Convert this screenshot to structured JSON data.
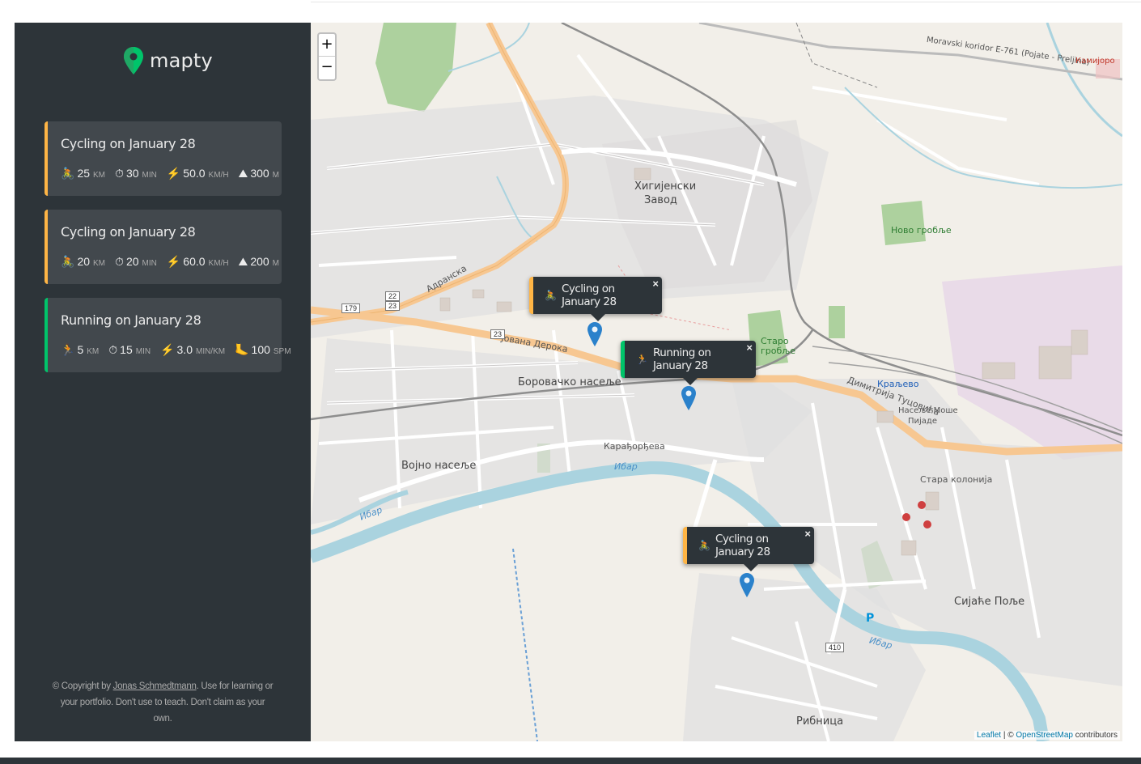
{
  "app": {
    "logo_text": "mapty",
    "brand_color": "#00c46a",
    "cycling_color": "#ffb545",
    "running_color": "#00c46a"
  },
  "workouts": [
    {
      "type": "cycling",
      "title": "Cycling on January 28",
      "d1_icon": "🚴",
      "d1_val": "25",
      "d1_unit": "KM",
      "d2_icon": "⏱",
      "d2_val": "30",
      "d2_unit": "MIN",
      "d3_icon": "⚡️",
      "d3_val": "50.0",
      "d3_unit": "KM/H",
      "d4_icon": "⛰",
      "d4_val": "300",
      "d4_unit": "M"
    },
    {
      "type": "cycling",
      "title": "Cycling on January 28",
      "d1_icon": "🚴",
      "d1_val": "20",
      "d1_unit": "KM",
      "d2_icon": "⏱",
      "d2_val": "20",
      "d2_unit": "MIN",
      "d3_icon": "⚡️",
      "d3_val": "60.0",
      "d3_unit": "KM/H",
      "d4_icon": "⛰",
      "d4_val": "200",
      "d4_unit": "M"
    },
    {
      "type": "running",
      "title": "Running on January 28",
      "d1_icon": "🏃",
      "d1_val": "5",
      "d1_unit": "KM",
      "d2_icon": "⏱",
      "d2_val": "15",
      "d2_unit": "MIN",
      "d3_icon": "⚡️",
      "d3_val": "3.0",
      "d3_unit": "MIN/KM",
      "d4_icon": "🦶",
      "d4_val": "100",
      "d4_unit": "SPM"
    }
  ],
  "footer": {
    "prefix": "© Copyright by",
    "author": "Jonas Schmedtmann",
    "suffix": ". Use for learning or your portfolio. Don't use to teach. Don't claim as your own."
  },
  "map": {
    "zoom_in": "+",
    "zoom_out": "−",
    "attribution_leaflet": "Leaflet",
    "attribution_sep": " | © ",
    "attribution_osm": "OpenStreetMap",
    "attribution_suffix": " contributors",
    "popups": [
      {
        "type": "cycling",
        "icon": "🚴",
        "text": "Cycling on January 28",
        "close": "×"
      },
      {
        "type": "running",
        "icon": "🏃",
        "text": "Running on January 28",
        "close": "×"
      },
      {
        "type": "cycling",
        "icon": "🚴",
        "text": "Cycling on January 28",
        "close": "×"
      }
    ],
    "labels": {
      "kraljevo": "Краљево",
      "hig_zavod1": "Хигијенски",
      "hig_zavod2": "Завод",
      "borcko": "Боровачко насеље",
      "vojno": "Војно насеље",
      "sijace": "Сијаће Поље",
      "ribnica": "Рибница",
      "stara_kolonija": "Стара колонија",
      "staro_groblje1": "Старо",
      "staro_groblje2": "гробље",
      "novo_groblje": "Ново гробље",
      "adranska": "Адранска",
      "ibar1": "Ибар",
      "ibar2": "Ибар",
      "ibar3": "Ибар",
      "jovana_deroka": "Јована Дерока",
      "karadjordjeva": "Карађорђева",
      "dimitrija": "Димитрија Туцовића",
      "moravski": "Moravski koridor E-761 (Pojate - Preljina)",
      "kamijoro": "Камијоро",
      "naselje_mose1": "Насеље Моше",
      "naselje_mose2": "Пијаде",
      "road_179": "179",
      "road_2223a": "22",
      "road_2223b": "23",
      "road_23": "23",
      "road_410": "410",
      "parking": "P"
    }
  }
}
